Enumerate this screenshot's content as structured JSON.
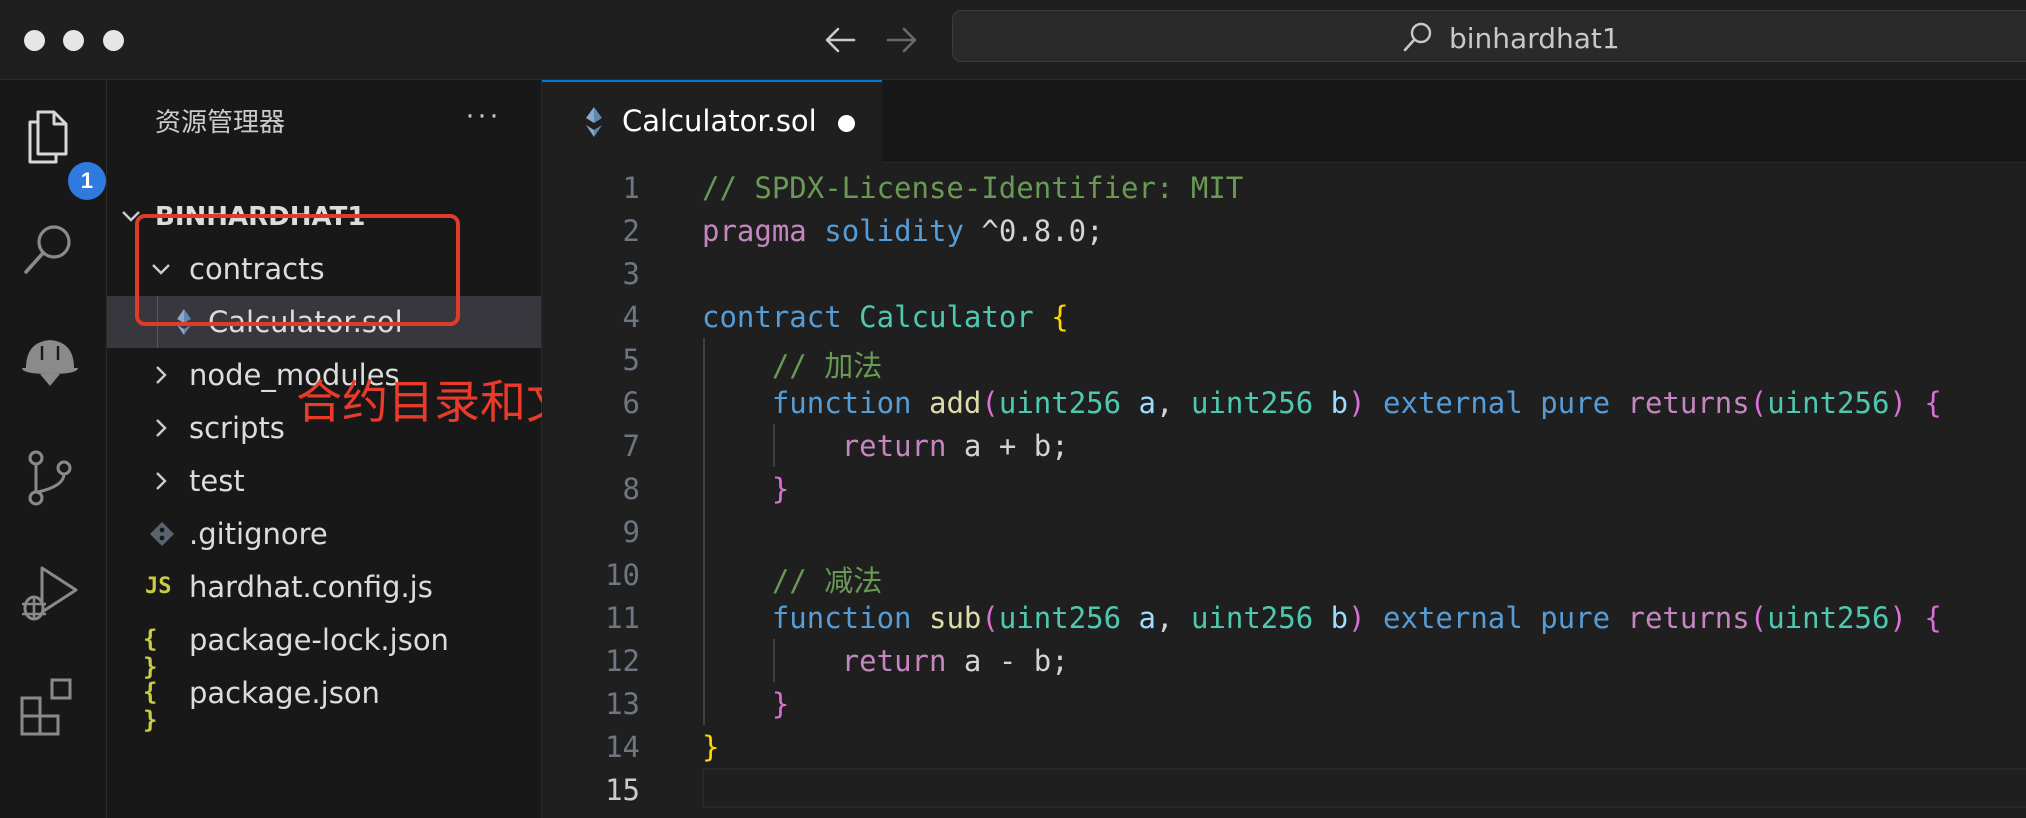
{
  "titlebar": {
    "search_text": "binhardhat1"
  },
  "activity_bar": {
    "explorer_badge": "1",
    "items": [
      "files-icon",
      "search-icon",
      "hardhat-icon",
      "source-control-icon",
      "run-debug-icon",
      "extensions-icon"
    ]
  },
  "sidebar": {
    "title": "资源管理器",
    "more": "···",
    "root": "BINHARDHAT1",
    "items": [
      {
        "label": "contracts",
        "type": "folder",
        "expanded": true
      },
      {
        "label": "Calculator.sol",
        "type": "file",
        "icon": "solidity-icon",
        "selected": true
      },
      {
        "label": "node_modules",
        "type": "folder",
        "expanded": false
      },
      {
        "label": "scripts",
        "type": "folder",
        "expanded": false
      },
      {
        "label": "test",
        "type": "folder",
        "expanded": false
      },
      {
        "label": ".gitignore",
        "type": "file",
        "icon": "git-icon"
      },
      {
        "label": "hardhat.config.js",
        "type": "file",
        "icon": "js-icon",
        "icon_text": "JS"
      },
      {
        "label": "package-lock.json",
        "type": "file",
        "icon": "json-icon",
        "icon_text": "{ }"
      },
      {
        "label": "package.json",
        "type": "file",
        "icon": "json-icon",
        "icon_text": "{ }"
      }
    ]
  },
  "annotation": {
    "text": "合约目录和文件",
    "color": "#ea3b2a"
  },
  "editor": {
    "tab_label": "Calculator.sol",
    "current_line": "15",
    "lines": [
      {
        "num": "1",
        "tokens": [
          {
            "t": "// SPDX-License-Identifier: MIT",
            "c": "comment"
          }
        ]
      },
      {
        "num": "2",
        "tokens": [
          {
            "t": "pragma",
            "c": "purple"
          },
          {
            "t": " ",
            "c": "plain"
          },
          {
            "t": "solidity",
            "c": "blue"
          },
          {
            "t": " ^0.8.0;",
            "c": "plain"
          }
        ]
      },
      {
        "num": "3",
        "tokens": []
      },
      {
        "num": "4",
        "tokens": [
          {
            "t": "contract",
            "c": "blue"
          },
          {
            "t": " ",
            "c": "plain"
          },
          {
            "t": "Calculator",
            "c": "teal"
          },
          {
            "t": " ",
            "c": "plain"
          },
          {
            "t": "{",
            "c": "brace"
          }
        ]
      },
      {
        "num": "5",
        "tokens": [
          {
            "t": "    ",
            "c": "plain"
          },
          {
            "t": "// 加法",
            "c": "comment"
          }
        ]
      },
      {
        "num": "6",
        "tokens": [
          {
            "t": "    ",
            "c": "plain"
          },
          {
            "t": "function",
            "c": "blue"
          },
          {
            "t": " ",
            "c": "plain"
          },
          {
            "t": "add",
            "c": "yellow"
          },
          {
            "t": "(",
            "c": "paren"
          },
          {
            "t": "uint256",
            "c": "teal"
          },
          {
            "t": " ",
            "c": "plain"
          },
          {
            "t": "a",
            "c": "var"
          },
          {
            "t": ", ",
            "c": "plain"
          },
          {
            "t": "uint256",
            "c": "teal"
          },
          {
            "t": " ",
            "c": "plain"
          },
          {
            "t": "b",
            "c": "var"
          },
          {
            "t": ")",
            "c": "paren"
          },
          {
            "t": " ",
            "c": "plain"
          },
          {
            "t": "external",
            "c": "blue"
          },
          {
            "t": " ",
            "c": "plain"
          },
          {
            "t": "pure",
            "c": "blue"
          },
          {
            "t": " ",
            "c": "plain"
          },
          {
            "t": "returns",
            "c": "purple"
          },
          {
            "t": "(",
            "c": "paren"
          },
          {
            "t": "uint256",
            "c": "teal"
          },
          {
            "t": ")",
            "c": "paren"
          },
          {
            "t": " ",
            "c": "plain"
          },
          {
            "t": "{",
            "c": "paren"
          }
        ]
      },
      {
        "num": "7",
        "tokens": [
          {
            "t": "        ",
            "c": "plain"
          },
          {
            "t": "return",
            "c": "purple"
          },
          {
            "t": " a + b;",
            "c": "plain"
          }
        ]
      },
      {
        "num": "8",
        "tokens": [
          {
            "t": "    ",
            "c": "plain"
          },
          {
            "t": "}",
            "c": "paren"
          }
        ]
      },
      {
        "num": "9",
        "tokens": []
      },
      {
        "num": "10",
        "tokens": [
          {
            "t": "    ",
            "c": "plain"
          },
          {
            "t": "// 减法",
            "c": "comment"
          }
        ]
      },
      {
        "num": "11",
        "tokens": [
          {
            "t": "    ",
            "c": "plain"
          },
          {
            "t": "function",
            "c": "blue"
          },
          {
            "t": " ",
            "c": "plain"
          },
          {
            "t": "sub",
            "c": "yellow"
          },
          {
            "t": "(",
            "c": "paren"
          },
          {
            "t": "uint256",
            "c": "teal"
          },
          {
            "t": " ",
            "c": "plain"
          },
          {
            "t": "a",
            "c": "var"
          },
          {
            "t": ", ",
            "c": "plain"
          },
          {
            "t": "uint256",
            "c": "teal"
          },
          {
            "t": " ",
            "c": "plain"
          },
          {
            "t": "b",
            "c": "var"
          },
          {
            "t": ")",
            "c": "paren"
          },
          {
            "t": " ",
            "c": "plain"
          },
          {
            "t": "external",
            "c": "blue"
          },
          {
            "t": " ",
            "c": "plain"
          },
          {
            "t": "pure",
            "c": "blue"
          },
          {
            "t": " ",
            "c": "plain"
          },
          {
            "t": "returns",
            "c": "purple"
          },
          {
            "t": "(",
            "c": "paren"
          },
          {
            "t": "uint256",
            "c": "teal"
          },
          {
            "t": ")",
            "c": "paren"
          },
          {
            "t": " ",
            "c": "plain"
          },
          {
            "t": "{",
            "c": "paren"
          }
        ]
      },
      {
        "num": "12",
        "tokens": [
          {
            "t": "        ",
            "c": "plain"
          },
          {
            "t": "return",
            "c": "purple"
          },
          {
            "t": " a - b;",
            "c": "plain"
          }
        ]
      },
      {
        "num": "13",
        "tokens": [
          {
            "t": "    ",
            "c": "plain"
          },
          {
            "t": "}",
            "c": "paren"
          }
        ]
      },
      {
        "num": "14",
        "tokens": [
          {
            "t": "}",
            "c": "brace"
          }
        ]
      },
      {
        "num": "15",
        "tokens": []
      }
    ]
  }
}
